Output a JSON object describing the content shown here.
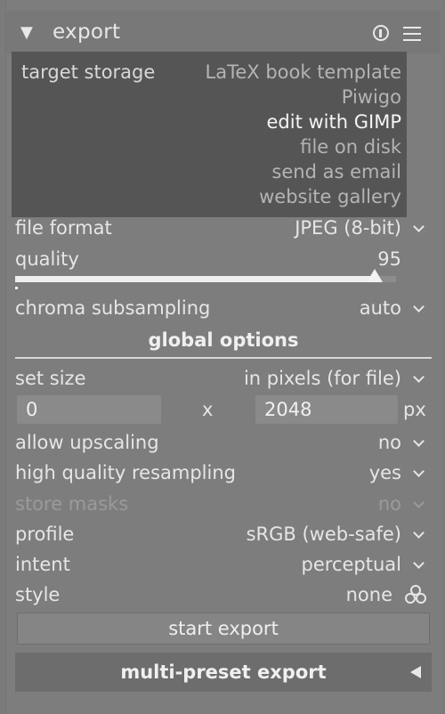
{
  "header": {
    "collapse_arrow": "▼",
    "title": "export",
    "info_icon": "info-icon",
    "presets_icon": "hamburger-menu-icon"
  },
  "target_storage": {
    "label": "target storage",
    "options": [
      "LaTeX book template",
      "Piwigo",
      "edit with GIMP",
      "file on disk",
      "send as email",
      "website gallery"
    ],
    "selected": "edit with GIMP"
  },
  "file_format": {
    "label": "file format",
    "value": "JPEG (8-bit)"
  },
  "quality": {
    "label": "quality",
    "value": "95",
    "level": 95
  },
  "chroma": {
    "label": "chroma subsampling",
    "value": "auto"
  },
  "global_options": {
    "title": "global options"
  },
  "set_size": {
    "label": "set size",
    "value": "in pixels (for file)",
    "width": "0",
    "x": "x",
    "height": "2048",
    "unit": "px"
  },
  "upscaling": {
    "label": "allow upscaling",
    "value": "no"
  },
  "resampling": {
    "label": "high quality resampling",
    "value": "yes"
  },
  "store_masks": {
    "label": "store masks",
    "value": "no"
  },
  "profile": {
    "label": "profile",
    "value": "sRGB (web-safe)"
  },
  "intent": {
    "label": "intent",
    "value": "perceptual"
  },
  "style": {
    "label": "style",
    "value": "none"
  },
  "buttons": {
    "start_export": "start export",
    "multi_preset": "multi-preset export"
  }
}
